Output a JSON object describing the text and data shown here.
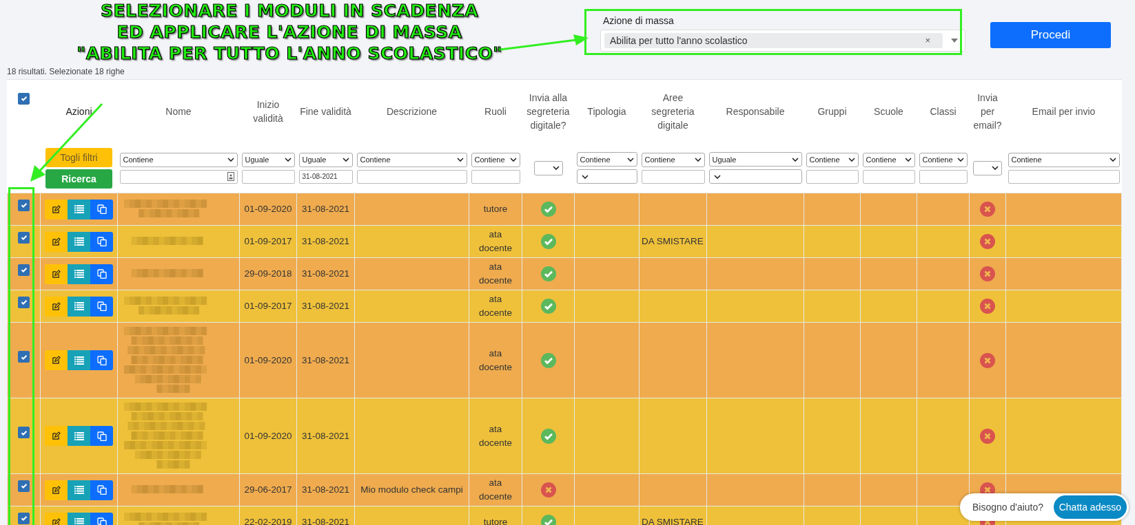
{
  "annotation": {
    "lines": [
      "SELEZIONARE I MODULI IN SCADENZA",
      "ED APPLICARE L'AZIONE DI MASSA",
      "\"ABILITA PER TUTTO L'ANNO SCOLASTICO\""
    ]
  },
  "mass_action": {
    "label": "Azione di massa",
    "value": "Abilita per tutto l'anno scolastico",
    "clear": "×"
  },
  "proceed_button": "Procedi",
  "summary": "18 risultati. Selezionate 18 righe",
  "table": {
    "select_all": {
      "checked": true
    },
    "columns": [
      {
        "label": "Azioni"
      },
      {
        "label": "Nome"
      },
      {
        "label": "Inizio validità"
      },
      {
        "label": "Fine validità"
      },
      {
        "label": "Descrizione"
      },
      {
        "label": "Ruoli"
      },
      {
        "label": "Invia alla segreteria digitale?"
      },
      {
        "label": "Tipologia"
      },
      {
        "label": "Aree segreteria digitale"
      },
      {
        "label": "Responsabile"
      },
      {
        "label": "Gruppi"
      },
      {
        "label": "Scuole"
      },
      {
        "label": "Classi"
      },
      {
        "label": "Invia per email?"
      },
      {
        "label": "Email per invio"
      }
    ],
    "filter_buttons": [
      {
        "label": "Togli filtri",
        "kind": "warning"
      },
      {
        "label": "Ricerca",
        "kind": "success"
      }
    ],
    "filters": [
      {
        "kind": "picker",
        "operator": "Contiene"
      },
      {
        "kind": "text",
        "operator": "Uguale"
      },
      {
        "kind": "text",
        "operator": "Uguale",
        "value": "31-08-2021"
      },
      {
        "kind": "text",
        "operator": "Contiene"
      },
      {
        "kind": "text",
        "operator": "Contiene"
      },
      {
        "kind": "bool"
      },
      {
        "kind": "select",
        "operator": "Contiene"
      },
      {
        "kind": "text",
        "operator": "Contiene"
      },
      {
        "kind": "select",
        "operator": "Uguale"
      },
      {
        "kind": "text",
        "operator": "Contiene"
      },
      {
        "kind": "text",
        "operator": "Contiene"
      },
      {
        "kind": "text",
        "operator": "Contiene"
      },
      {
        "kind": "bool"
      },
      {
        "kind": "text",
        "operator": "Contiene"
      }
    ],
    "rows": [
      {
        "checked": true,
        "kind": "short",
        "inizio": "01-09-2020",
        "fine": "31-08-2021",
        "ruoli": "tutore",
        "segreteria": true,
        "email": false
      },
      {
        "checked": true,
        "kind": "line",
        "inizio": "01-09-2017",
        "fine": "31-08-2021",
        "ruoli": "ata docente",
        "segreteria": true,
        "aree": "DA SMISTARE",
        "email": false
      },
      {
        "checked": true,
        "kind": "line",
        "inizio": "29-09-2018",
        "fine": "31-08-2021",
        "ruoli": "ata docente",
        "segreteria": true,
        "email": false
      },
      {
        "checked": true,
        "kind": "short",
        "inizio": "01-09-2017",
        "fine": "31-08-2021",
        "ruoli": "ata docente",
        "segreteria": true,
        "email": false
      },
      {
        "checked": true,
        "kind": "tall",
        "inizio": "01-09-2020",
        "fine": "31-08-2021",
        "ruoli": "ata docente",
        "segreteria": true,
        "email": false
      },
      {
        "checked": true,
        "kind": "tall",
        "inizio": "01-09-2020",
        "fine": "31-08-2021",
        "ruoli": "ata docente",
        "segreteria": true,
        "email": false
      },
      {
        "checked": true,
        "kind": "line",
        "inizio": "29-06-2017",
        "fine": "31-08-2021",
        "descrizione": "Mio modulo check campi",
        "ruoli": "ata docente",
        "segreteria": false,
        "email": false
      },
      {
        "checked": true,
        "kind": "short",
        "inizio": "22-02-2019",
        "fine": "31-08-2021",
        "ruoli": "tutore",
        "segreteria": true,
        "aree": "DA SMISTARE",
        "email": false
      }
    ]
  },
  "chat": {
    "prompt": "Bisogno d'aiuto?",
    "button": "Chatta adesso"
  }
}
